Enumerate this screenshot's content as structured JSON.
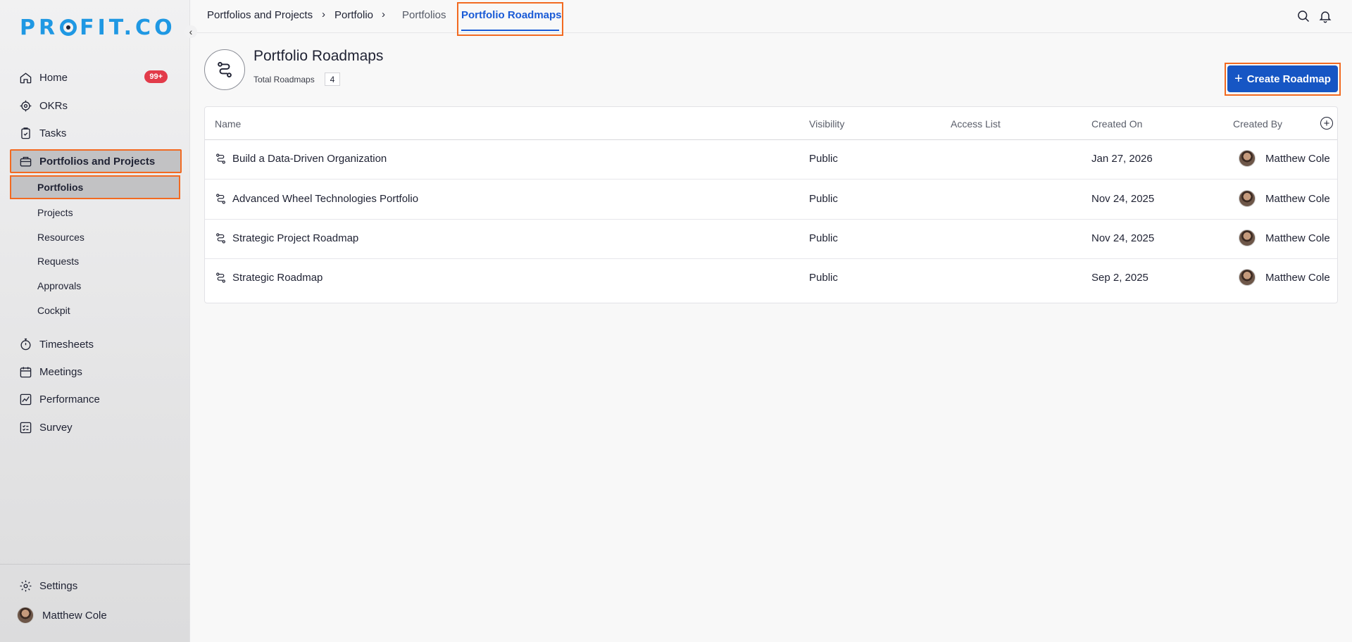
{
  "app": {
    "logo_left": "PR",
    "logo_right": "FIT.CO"
  },
  "sidebar": {
    "items": [
      {
        "label": "Home",
        "icon": "home-icon",
        "badge": "99+"
      },
      {
        "label": "OKRs",
        "icon": "target-icon"
      },
      {
        "label": "Tasks",
        "icon": "clipboard-icon"
      },
      {
        "label": "Portfolios and Projects",
        "icon": "briefcase-icon",
        "active": true
      },
      {
        "label": "Timesheets",
        "icon": "stopwatch-icon"
      },
      {
        "label": "Meetings",
        "icon": "calendar-icon"
      },
      {
        "label": "Performance",
        "icon": "chart-line-icon"
      },
      {
        "label": "Survey",
        "icon": "checklist-icon"
      }
    ],
    "subitems": [
      "Portfolios",
      "Projects",
      "Resources",
      "Requests",
      "Approvals",
      "Cockpit"
    ],
    "settings_label": "Settings",
    "user_name": "Matthew Cole"
  },
  "topbar": {
    "breadcrumbs": [
      "Portfolios and Projects",
      "Portfolio"
    ],
    "tabs": [
      "Portfolios",
      "Portfolio Roadmaps"
    ],
    "active_tab": "Portfolio Roadmaps"
  },
  "page": {
    "title": "Portfolio Roadmaps",
    "total_label": "Total Roadmaps",
    "total_count": "4",
    "create_button": "Create Roadmap"
  },
  "table": {
    "columns": [
      "Name",
      "Visibility",
      "Access List",
      "Created On",
      "Created By"
    ],
    "rows": [
      {
        "name": "Build a Data-Driven Organization",
        "visibility": "Public",
        "access": "",
        "created_on": "Jan 27, 2026",
        "created_by": "Matthew Cole"
      },
      {
        "name": "Advanced Wheel Technologies Portfolio",
        "visibility": "Public",
        "access": "",
        "created_on": "Nov 24, 2025",
        "created_by": "Matthew Cole"
      },
      {
        "name": "Strategic Project Roadmap",
        "visibility": "Public",
        "access": "",
        "created_on": "Nov 24, 2025",
        "created_by": "Matthew Cole"
      },
      {
        "name": "Strategic Roadmap",
        "visibility": "Public",
        "access": "",
        "created_on": "Sep 2, 2025",
        "created_by": "Matthew Cole"
      }
    ]
  },
  "colors": {
    "accent": "#1656c4",
    "logo": "#1f98e3",
    "highlight": "#f26a21",
    "badge": "#e23b4a"
  }
}
